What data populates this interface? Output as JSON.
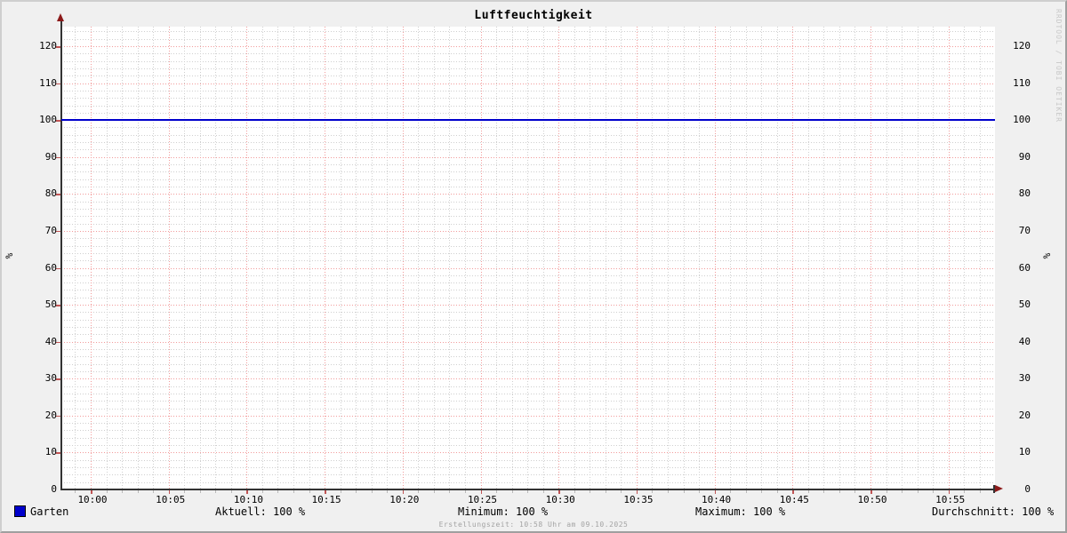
{
  "watermark": "RRDTOOL / TOBI OETIKER",
  "footer": {
    "creation": "Erstellungszeit: 10:58 Uhr am 09.10.2025"
  },
  "legend": {
    "series": {
      "label": "Garten",
      "color": "#0000cc"
    },
    "stats": {
      "aktuell": "Aktuell: 100 %",
      "minimum": "Minimum: 100 %",
      "maximum": "Maximum: 100 %",
      "durchschnitt": "Durchschnitt: 100 %"
    }
  },
  "chart_data": {
    "type": "line",
    "title": "Luftfeuchtigkeit",
    "ylabel": "%",
    "categories": [
      "10:00",
      "10:05",
      "10:10",
      "10:15",
      "10:20",
      "10:25",
      "10:30",
      "10:35",
      "10:40",
      "10:45",
      "10:50",
      "10:55"
    ],
    "y_ticks": [
      0,
      10,
      20,
      30,
      40,
      50,
      60,
      70,
      80,
      90,
      100,
      110,
      120
    ],
    "ylim": [
      0,
      125
    ],
    "x_minor_step_minutes": 1,
    "x_major_step_minutes": 5,
    "series": [
      {
        "name": "Garten",
        "color": "#0000cc",
        "values": [
          100,
          100,
          100,
          100,
          100,
          100,
          100,
          100,
          100,
          100,
          100,
          100
        ]
      }
    ],
    "grid": true,
    "legend_position": "bottom"
  },
  "colors": {
    "background": "#f0f0f0",
    "canvas": "#ffffff",
    "axis": "#333333",
    "arrow": "#8c1a1a",
    "major_grid": "#f29b9b",
    "major_tick": "#c05454",
    "minor_grid": "#cfcfcf",
    "minor_tick": "#b9b9b9",
    "series_line": "#0000cc",
    "watermark_text": "#c8c8c8",
    "footer_text": "#a3a3a3"
  }
}
